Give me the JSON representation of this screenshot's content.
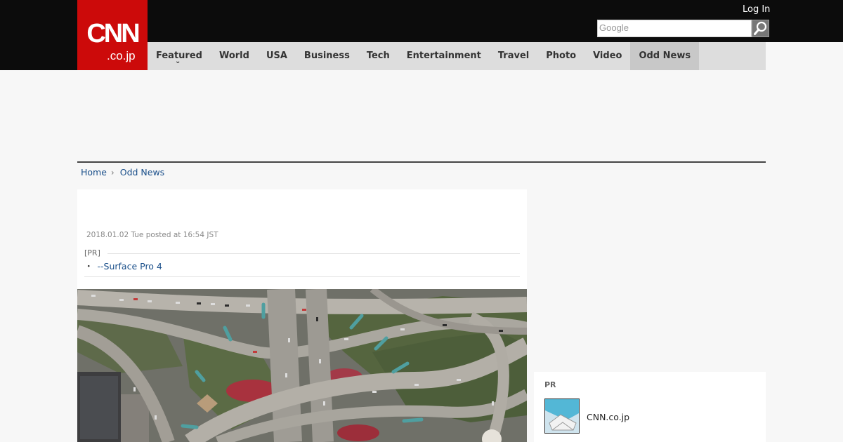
{
  "header": {
    "logo_text": "CNN",
    "logo_sub": ".co.jp",
    "login_label": "Log In",
    "search": {
      "placeholder": "Google"
    },
    "brand_color": "#cc0a0a"
  },
  "nav": {
    "items": [
      {
        "label": "Featured"
      },
      {
        "label": "World"
      },
      {
        "label": "USA"
      },
      {
        "label": "Business"
      },
      {
        "label": "Tech"
      },
      {
        "label": "Entertainment"
      },
      {
        "label": "Travel"
      },
      {
        "label": "Photo"
      },
      {
        "label": "Video"
      },
      {
        "label": "Odd News"
      }
    ],
    "active": "Odd News"
  },
  "breadcrumb": {
    "home": "Home",
    "current": "Odd News"
  },
  "article": {
    "dateline": "2018.01.02 Tue posted at 16:54 JST",
    "pr_label": "[PR]",
    "pr_bullet": "・",
    "pr_link": "--Surface Pro 4",
    "photo_subject": "aerial view of highway interchange"
  },
  "sidebar": {
    "pr_label": "PR",
    "pr_item_name": "CNN.co.jp"
  }
}
